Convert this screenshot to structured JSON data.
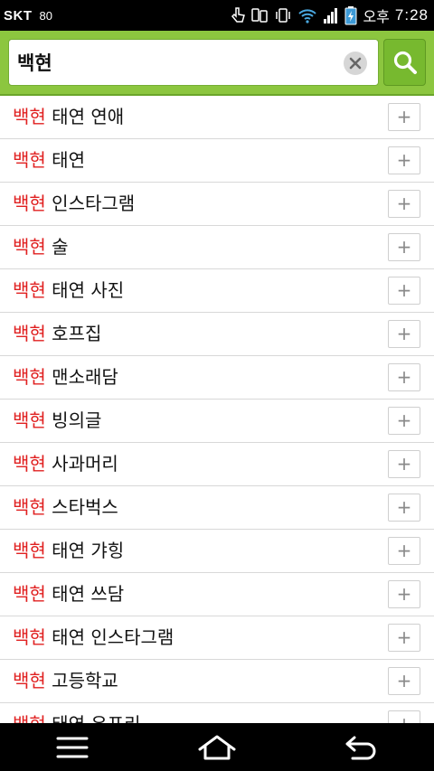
{
  "status_bar": {
    "carrier": "SKT",
    "notification_count": "80",
    "ampm": "오후",
    "time": "7:28"
  },
  "search": {
    "query": "백현",
    "clear_icon": "close-icon",
    "search_icon": "search-icon"
  },
  "suggestions": [
    {
      "keyword": "백현",
      "suffix": " 태연 연애",
      "add_label": "+"
    },
    {
      "keyword": "백현",
      "suffix": " 태연",
      "add_label": "+"
    },
    {
      "keyword": "백현",
      "suffix": " 인스타그램",
      "add_label": "+"
    },
    {
      "keyword": "백현",
      "suffix": " 술",
      "add_label": "+"
    },
    {
      "keyword": "백현",
      "suffix": " 태연 사진",
      "add_label": "+"
    },
    {
      "keyword": "백현",
      "suffix": " 호프집",
      "add_label": "+"
    },
    {
      "keyword": "백현",
      "suffix": " 맨소래담",
      "add_label": "+"
    },
    {
      "keyword": "백현",
      "suffix": " 빙의글",
      "add_label": "+"
    },
    {
      "keyword": "백현",
      "suffix": " 사과머리",
      "add_label": "+"
    },
    {
      "keyword": "백현",
      "suffix": " 스타벅스",
      "add_label": "+"
    },
    {
      "keyword": "백현",
      "suffix": " 태연 갸힝",
      "add_label": "+"
    },
    {
      "keyword": "백현",
      "suffix": " 태연 쓰담",
      "add_label": "+"
    },
    {
      "keyword": "백현",
      "suffix": " 태연 인스타그램",
      "add_label": "+"
    },
    {
      "keyword": "백현",
      "suffix": " 고등학교",
      "add_label": "+"
    },
    {
      "keyword": "백현",
      "suffix": " 태연 유포리",
      "add_label": "+"
    }
  ],
  "nav": {
    "menu_icon": "menu-icon",
    "home_icon": "home-icon",
    "back_icon": "back-icon"
  },
  "colors": {
    "header_green": "#8cc63f",
    "keyword_red": "#e02020"
  }
}
